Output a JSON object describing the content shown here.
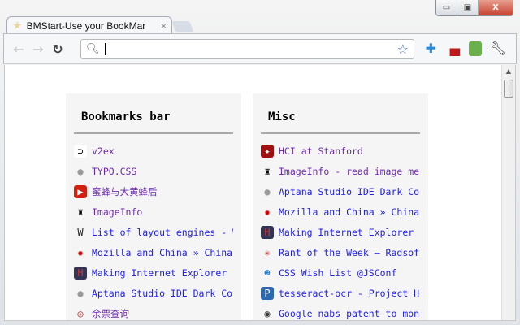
{
  "window": {
    "minimize": "▭",
    "maximize": "▣",
    "close": "X"
  },
  "tab": {
    "title": "BMStart-Use your BookMar",
    "close": "×"
  },
  "toolbar": {
    "back": "←",
    "forward": "→",
    "reload": "C",
    "address_value": "",
    "extensions": [
      "puzzle-icon",
      "sofa-icon",
      "evernote-icon",
      "wrench-icon"
    ]
  },
  "columns": [
    {
      "title": "Bookmarks bar",
      "items": [
        {
          "label": "v2ex",
          "icon": "v2ex-icon",
          "visited": true
        },
        {
          "label": "TYPO.CSS",
          "icon": "globe-icon",
          "visited": true
        },
        {
          "label": "蜜蜂与大黄蜂后",
          "icon": "video-icon",
          "visited": true
        },
        {
          "label": "ImageInfo",
          "icon": "imageinfo-icon",
          "visited": true
        },
        {
          "label": "List of layout engines - Wikipedia",
          "icon": "wikipedia-icon",
          "visited": false
        },
        {
          "label": "Mozilla and China » China",
          "icon": "mozilla-icon",
          "visited": false
        },
        {
          "label": "Making Internet Explorer",
          "icon": "h2c-icon",
          "visited": false
        },
        {
          "label": "Aptana Studio IDE Dark Color",
          "icon": "globe-icon",
          "visited": false
        },
        {
          "label": "余票查询",
          "icon": "railway-icon",
          "visited": true
        }
      ]
    },
    {
      "title": "Misc",
      "items": [
        {
          "label": "HCI at Stanford",
          "icon": "stanford-icon",
          "visited": true
        },
        {
          "label": "ImageInfo - read image meta",
          "icon": "imageinfo-icon",
          "visited": true
        },
        {
          "label": "Aptana Studio IDE Dark Color",
          "icon": "globe-icon",
          "visited": false
        },
        {
          "label": "Mozilla and China » China",
          "icon": "mozilla-icon",
          "visited": false
        },
        {
          "label": "Making Internet Explorer",
          "icon": "h2c-icon",
          "visited": false
        },
        {
          "label": "Rant of the Week — Radsoft",
          "icon": "rant-icon",
          "visited": false
        },
        {
          "label": "CSS Wish List @JSConf",
          "icon": "slideshare-icon",
          "visited": false
        },
        {
          "label": "tesseract-ocr - Project Hosting",
          "icon": "project-icon",
          "visited": false
        },
        {
          "label": "Google nabs patent to monitor",
          "icon": "eye-icon",
          "visited": false
        }
      ]
    }
  ]
}
